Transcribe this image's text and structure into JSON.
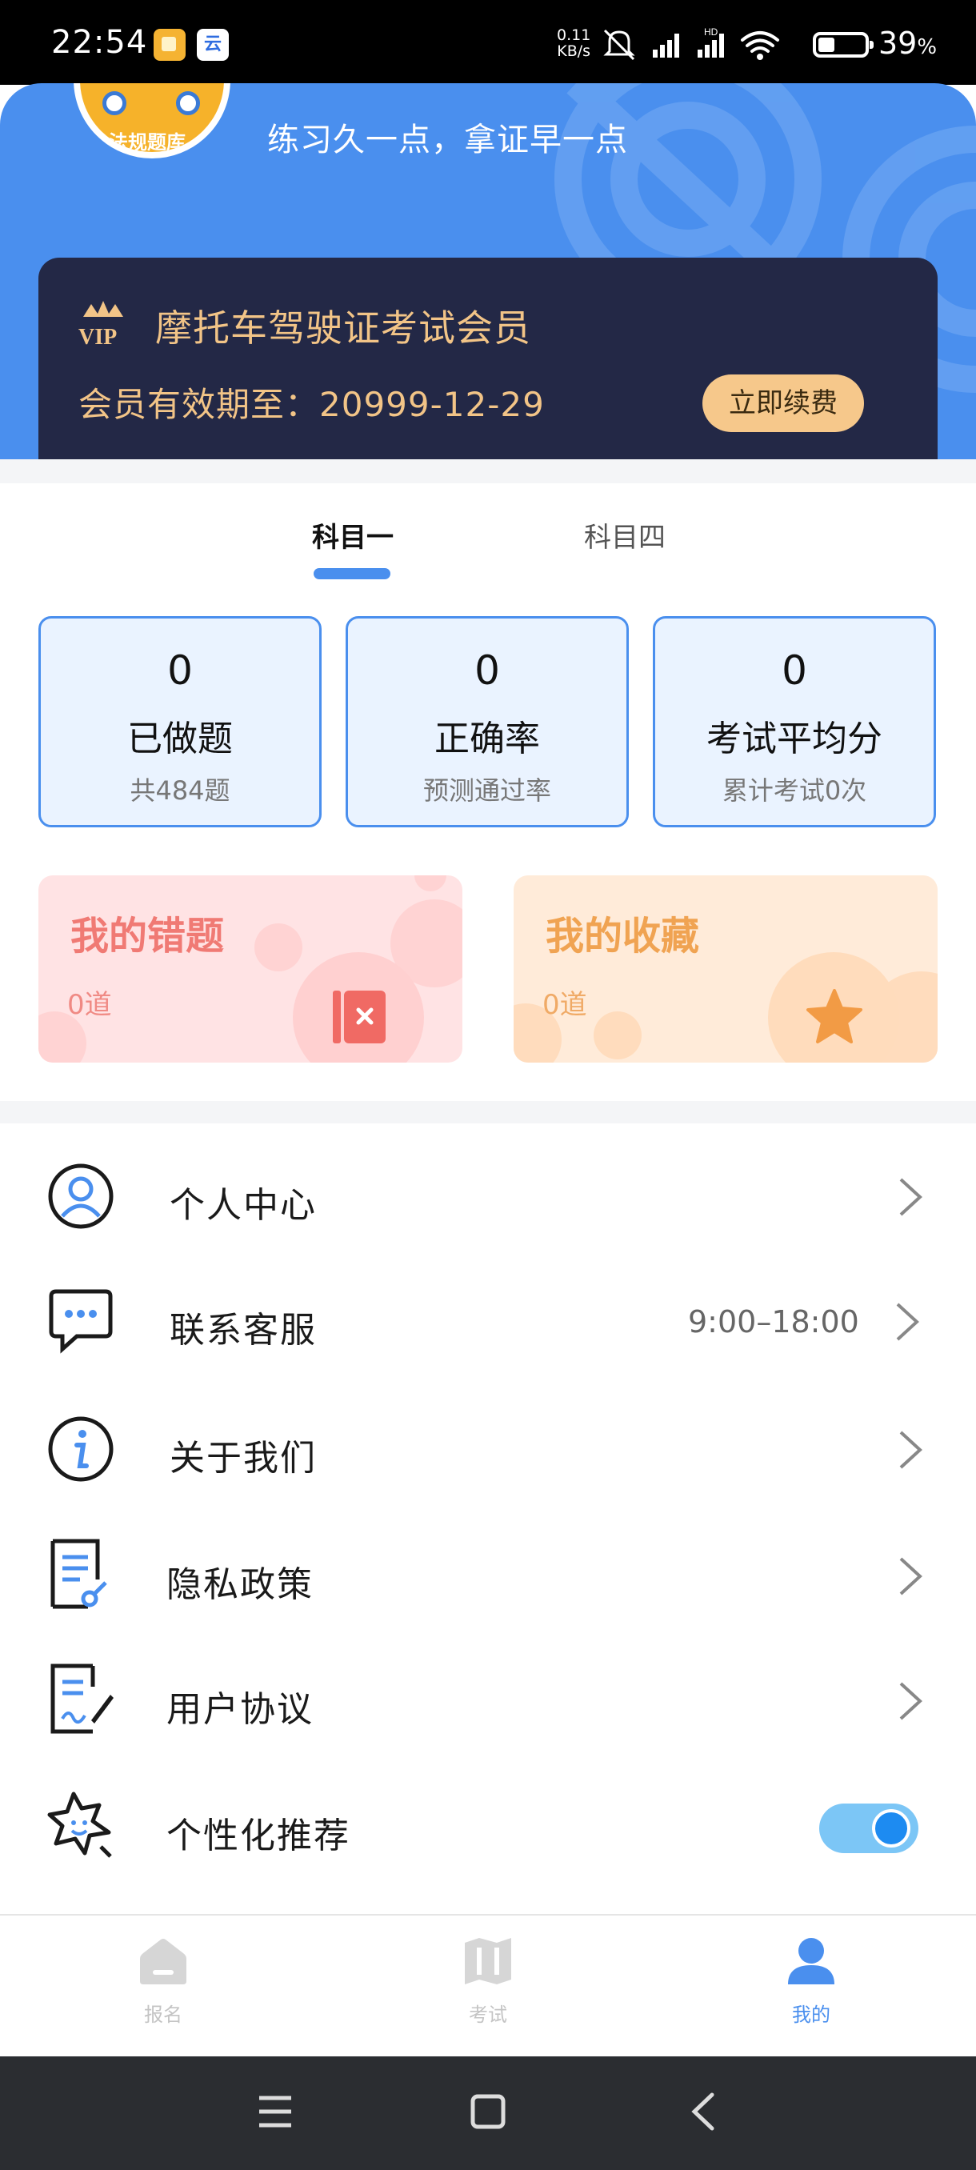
{
  "status_bar": {
    "time": "22:54",
    "app_icon_2": "云",
    "net_speed_value": "0.11",
    "net_speed_unit": "KB/s",
    "network_badge": "HD",
    "battery_percent": "39",
    "battery_unit": "%"
  },
  "header": {
    "slogan": "练习久一点，拿证早一点",
    "avatar_text": "法规题库",
    "vip": {
      "badge": "VIP",
      "title": "摩托车驾驶证考试会员",
      "expire_label": "会员有效期至：",
      "expire_date": "20999-12-29",
      "renew_button": "立即续费"
    }
  },
  "tabs": [
    {
      "label": "科目一",
      "active": true
    },
    {
      "label": "科目四",
      "active": false
    }
  ],
  "stats": [
    {
      "value": "0",
      "label": "已做题",
      "sub": "共484题"
    },
    {
      "value": "0",
      "label": "正确率",
      "sub": "预测通过率"
    },
    {
      "value": "0",
      "label": "考试平均分",
      "sub": "累计考试0次"
    }
  ],
  "cards": {
    "wrong": {
      "title": "我的错题",
      "count": "0道"
    },
    "favorites": {
      "title": "我的收藏",
      "count": "0道"
    }
  },
  "menu": [
    {
      "label": "个人中心",
      "icon": "user-icon"
    },
    {
      "label": "联系客服",
      "icon": "chat-icon",
      "extra": "9:00–18:00"
    },
    {
      "label": "关于我们",
      "icon": "info-icon"
    },
    {
      "label": "隐私政策",
      "icon": "document-icon"
    },
    {
      "label": "用户协议",
      "icon": "agreement-icon"
    },
    {
      "label": "个性化推荐",
      "icon": "star-sparkle-icon",
      "toggle_on": true
    }
  ],
  "bottom_nav": [
    {
      "label": "报名",
      "icon": "home-icon",
      "active": false
    },
    {
      "label": "考试",
      "icon": "map-icon",
      "active": false
    },
    {
      "label": "我的",
      "icon": "profile-icon",
      "active": true
    }
  ],
  "colors": {
    "primary": "#4a8fee",
    "vip_bg": "#232846",
    "vip_gold": "#f2c487",
    "wrong_red": "#f07a74",
    "fav_orange": "#f0a352"
  }
}
